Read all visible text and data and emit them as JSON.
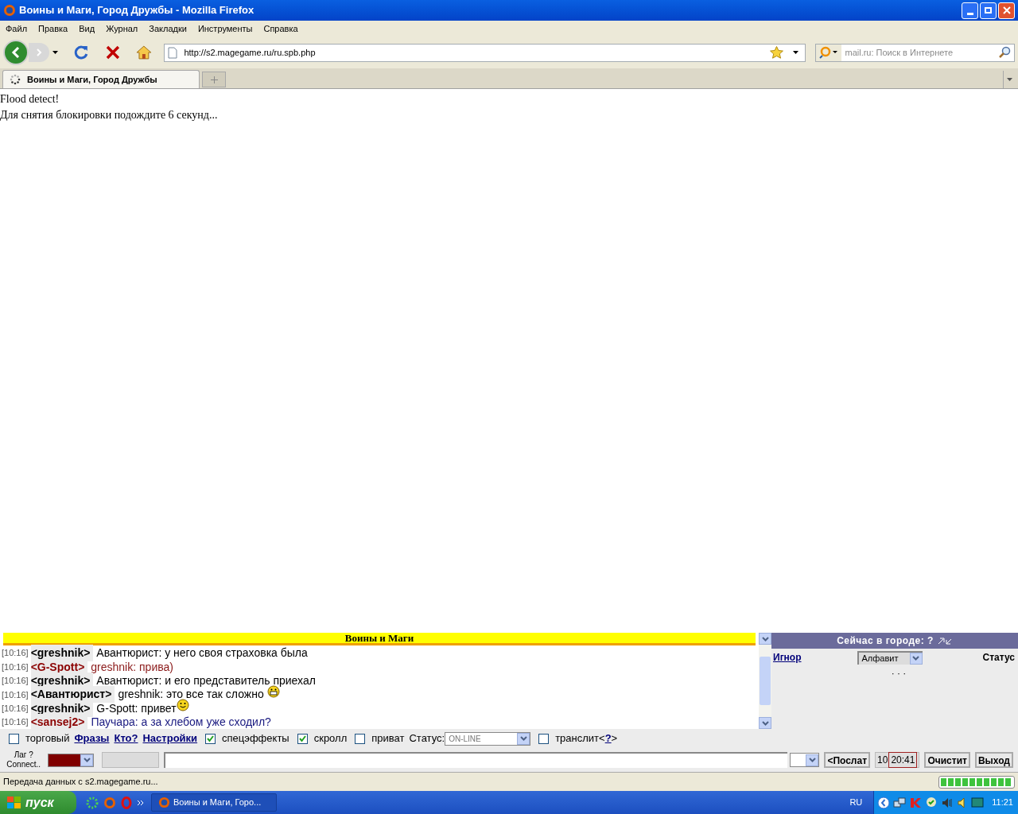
{
  "window": {
    "title": "Воины и Маги, Город Дружбы - Mozilla Firefox"
  },
  "menu": [
    "Файл",
    "Правка",
    "Вид",
    "Журнал",
    "Закладки",
    "Инструменты",
    "Справка"
  ],
  "address": {
    "value": "http://s2.magegame.ru/ru.spb.php"
  },
  "search": {
    "placeholder": "mail.ru: Поиск в Интернете"
  },
  "tabs": [
    {
      "label": "Воины и Маги, Город Дружбы",
      "selected": true
    }
  ],
  "page": {
    "lines": [
      "Flood detect!",
      "Для снятия блокировки подождите 6 секунд..."
    ]
  },
  "chat": {
    "banner": "Воины и Маги",
    "messages": [
      {
        "kind": "plain",
        "time": "[10:16]",
        "nick": {
          "text": "<greshnik>",
          "color": "#000000"
        },
        "body": {
          "text": "Авантюрист: у него своя страховка была",
          "color": "#000000"
        }
      },
      {
        "kind": "plain",
        "time": "[10:16]",
        "nick": {
          "text": "<G-Spott>",
          "color": "#8b0000"
        },
        "body": {
          "text": "greshnik: прива)",
          "color": "#8b1a1a"
        }
      },
      {
        "kind": "plain",
        "time": "[10:16]",
        "nick": {
          "text": "<greshnik>",
          "color": "#000000"
        },
        "body": {
          "text": "Авантюрист: и его представитель приехал",
          "color": "#000000"
        }
      },
      {
        "kind": "grin",
        "time": "[10:16]",
        "nick": {
          "text": "<Авантюрист>",
          "color": "#000000"
        },
        "body": {
          "text": "greshnik: это все так сложно",
          "color": "#000000"
        }
      },
      {
        "kind": "smile",
        "time": "[10:16]",
        "nick": {
          "text": "<greshnik>",
          "color": "#000000"
        },
        "body": {
          "text": "G-Spott: привет",
          "color": "#000000"
        }
      },
      {
        "kind": "plain",
        "time": "[10:16]",
        "nick": {
          "text": "<sansej2>",
          "color": "#8b0000"
        },
        "body": {
          "text": "Паучара: а за хлебом уже сходил?",
          "color": "#1a1a80"
        }
      }
    ],
    "options": [
      {
        "kind": "checkbox",
        "label": "торговый",
        "checked": false
      },
      {
        "kind": "link",
        "label": "Фразы"
      },
      {
        "kind": "link",
        "label": "Кто?"
      },
      {
        "kind": "link",
        "label": "Настройки"
      },
      {
        "kind": "checkbox",
        "label": "спецэффекты",
        "checked": true
      },
      {
        "kind": "checkbox",
        "label": "скролл",
        "checked": true
      },
      {
        "kind": "checkbox",
        "label": "приват",
        "checked": false
      },
      {
        "kind": "select",
        "label": "Статус:",
        "value": "ON-LINE"
      },
      {
        "kind": "checkbox",
        "label": "транслит<",
        "checked": false,
        "link": "?",
        "suffix": ">"
      }
    ],
    "lag": [
      "Лаг ?",
      "Connect.."
    ],
    "color_select": {
      "color": "#800000"
    },
    "send_button": "<Послат",
    "counter": "10",
    "clock": "20:41",
    "clear_button": "Очистит",
    "exit_button": "Выход"
  },
  "who": {
    "title": "Сейчас в городе: ?",
    "ignore_link": "Игнор",
    "sort": "Алфавит",
    "status_label": "Статус",
    "dots": "· · ·"
  },
  "status_bar": {
    "text": "Передача данных с s2.magegame.ru...",
    "level": 1.0
  },
  "taskbar": {
    "start": "пуск",
    "task": "Воины и Маги, Горо...",
    "language": "RU",
    "clock": "11:21"
  }
}
